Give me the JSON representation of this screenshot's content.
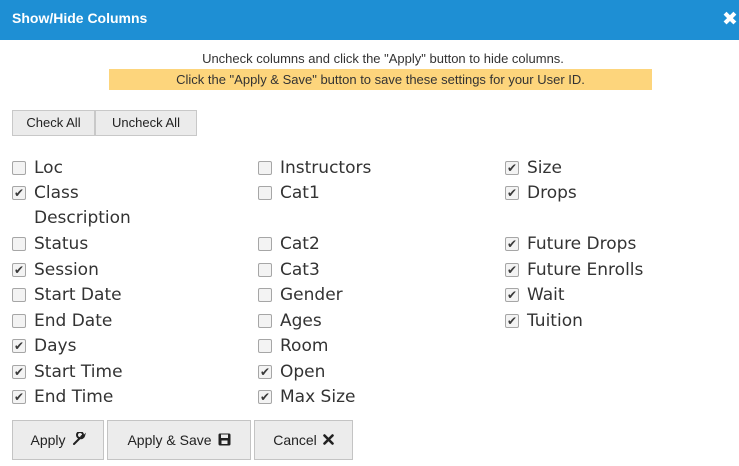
{
  "dialog": {
    "title": "Show/Hide Columns",
    "close_symbol": "✖",
    "instruction": "Uncheck columns and click the \"Apply\" button to hide columns.",
    "save_note": "Click the \"Apply & Save\" button to save these settings for your User ID."
  },
  "controls": {
    "check_all": "Check All",
    "uncheck_all": "Uncheck All"
  },
  "columns": [
    [
      {
        "label": "Loc",
        "checked": false
      },
      {
        "label": "Class Description",
        "checked": true
      },
      {
        "label": "Status",
        "checked": false
      },
      {
        "label": "Session",
        "checked": true
      },
      {
        "label": "Start Date",
        "checked": false
      },
      {
        "label": "End Date",
        "checked": false
      },
      {
        "label": "Days",
        "checked": true
      },
      {
        "label": "Start Time",
        "checked": true
      },
      {
        "label": "End Time",
        "checked": true
      }
    ],
    [
      {
        "label": "Instructors",
        "checked": false
      },
      {
        "label": "Cat1",
        "checked": false
      },
      {
        "label": "Cat2",
        "checked": false
      },
      {
        "label": "Cat3",
        "checked": false
      },
      {
        "label": "Gender",
        "checked": false
      },
      {
        "label": "Ages",
        "checked": false
      },
      {
        "label": "Room",
        "checked": false
      },
      {
        "label": "Open",
        "checked": true
      },
      {
        "label": "Max Size",
        "checked": true
      }
    ],
    [
      {
        "label": "Size",
        "checked": true
      },
      {
        "label": "Drops",
        "checked": true
      },
      {
        "label": "Future Drops",
        "checked": true
      },
      {
        "label": "Future Enrolls",
        "checked": true
      },
      {
        "label": "Wait",
        "checked": true
      },
      {
        "label": "Tuition",
        "checked": true
      }
    ]
  ],
  "footer": {
    "apply": {
      "label": "Apply",
      "icon": "wrench-icon"
    },
    "apply_save": {
      "label": "Apply & Save",
      "icon": "save-icon"
    },
    "cancel": {
      "label": "Cancel",
      "icon": "close-icon"
    }
  },
  "colors": {
    "titlebar": "#1e8fd4",
    "highlight": "#fdd57c"
  }
}
